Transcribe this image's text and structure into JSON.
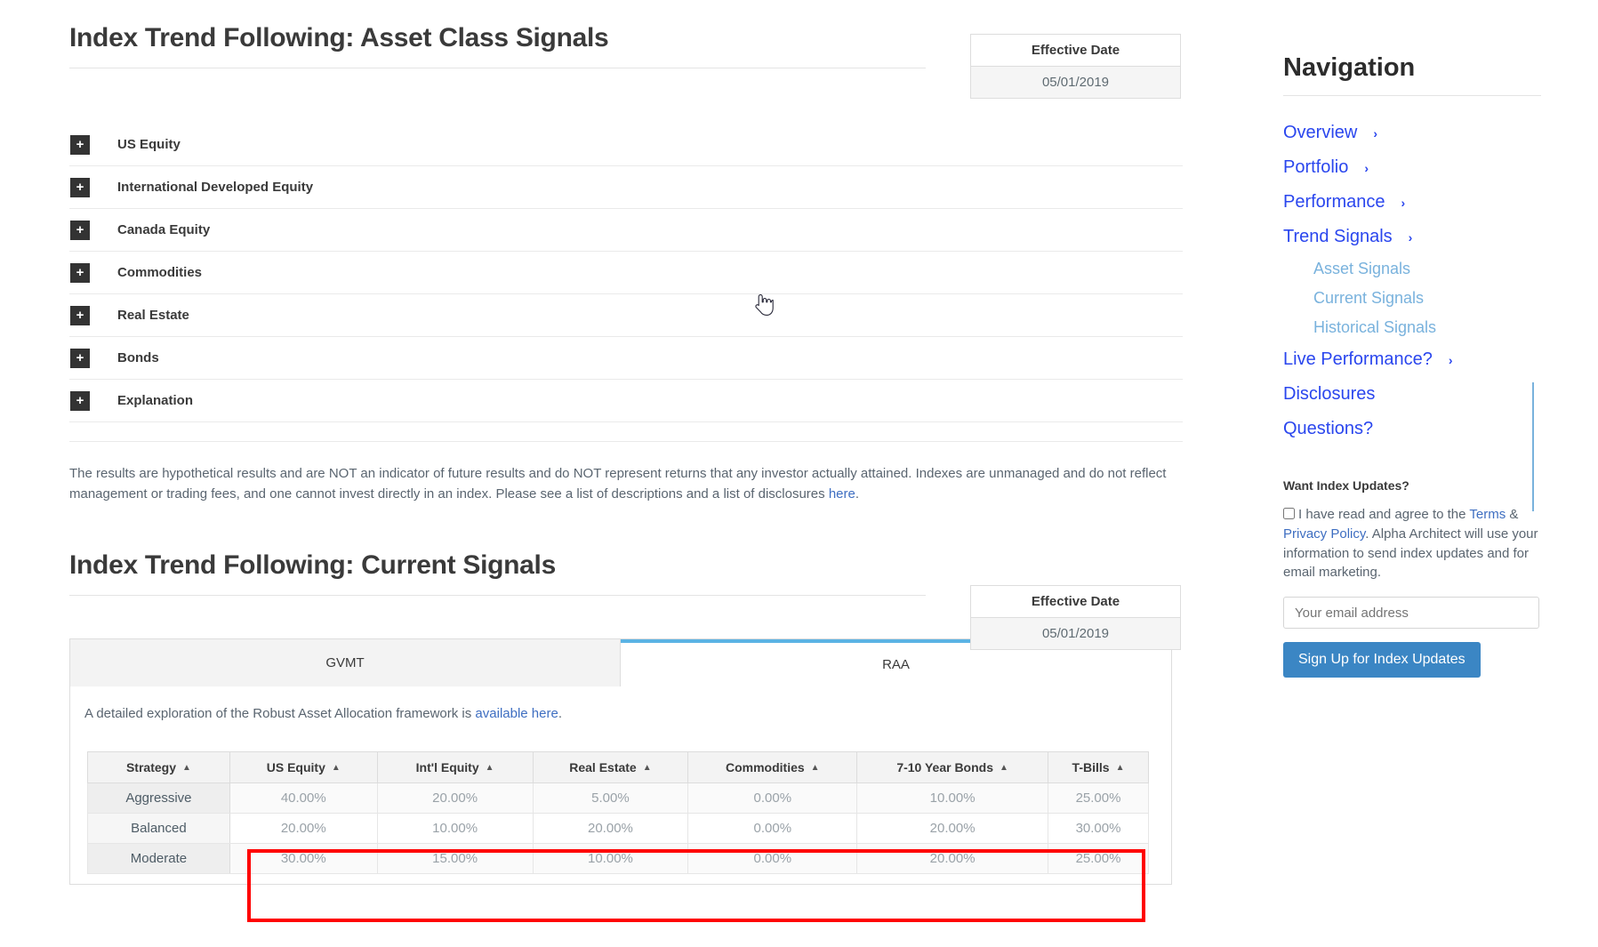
{
  "sections": [
    {
      "title": "Index Trend Following: Asset Class Signals",
      "effective_date": {
        "label": "Effective Date",
        "value": "05/01/2019"
      }
    },
    {
      "title": "Index Trend Following: Current Signals",
      "effective_date": {
        "label": "Effective Date",
        "value": "05/01/2019"
      }
    }
  ],
  "accordion": {
    "expand_icon": "+",
    "items": [
      {
        "label": "US Equity"
      },
      {
        "label": "International Developed Equity"
      },
      {
        "label": "Canada Equity"
      },
      {
        "label": "Commodities"
      },
      {
        "label": "Real Estate"
      },
      {
        "label": "Bonds"
      },
      {
        "label": "Explanation"
      }
    ]
  },
  "disclaimer": {
    "text_before_link": "The results are hypothetical results and are NOT an indicator of future results and do NOT represent returns that any investor actually attained. Indexes are unmanaged and do not reflect management or trading fees, and one cannot invest directly in an index. Please see a list of descriptions and a list of disclosures ",
    "link_text": "here",
    "text_after_link": "."
  },
  "tabs": [
    {
      "label": "GVMT",
      "active": false
    },
    {
      "label": "RAA",
      "active": true
    }
  ],
  "panel": {
    "note_before_link": "A detailed exploration of the Robust Asset Allocation framework is ",
    "note_link": "available here",
    "note_after_link": "."
  },
  "chart_data": {
    "type": "table",
    "title": "Index Trend Following: Current Signals — RAA",
    "columns": [
      "Strategy",
      "US Equity",
      "Int'l Equity",
      "Real Estate",
      "Commodities",
      "7-10 Year Bonds",
      "T-Bills"
    ],
    "sort_indicator": "▲",
    "rows": [
      {
        "Strategy": "Aggressive",
        "US Equity": "40.00%",
        "Int'l Equity": "20.00%",
        "Real Estate": "5.00%",
        "Commodities": "0.00%",
        "7-10 Year Bonds": "10.00%",
        "T-Bills": "25.00%"
      },
      {
        "Strategy": "Balanced",
        "US Equity": "20.00%",
        "Int'l Equity": "10.00%",
        "Real Estate": "20.00%",
        "Commodities": "0.00%",
        "7-10 Year Bonds": "20.00%",
        "T-Bills": "30.00%"
      },
      {
        "Strategy": "Moderate",
        "US Equity": "30.00%",
        "Int'l Equity": "15.00%",
        "Real Estate": "10.00%",
        "Commodities": "0.00%",
        "7-10 Year Bonds": "20.00%",
        "T-Bills": "25.00%"
      }
    ]
  },
  "annotation": {
    "highlight_color": "#ff0000"
  },
  "sidebar": {
    "title": "Navigation",
    "chevron": "›",
    "items": [
      {
        "label": "Overview",
        "has_chevron": true,
        "sub": false
      },
      {
        "label": "Portfolio",
        "has_chevron": true,
        "sub": false
      },
      {
        "label": "Performance",
        "has_chevron": true,
        "sub": false
      },
      {
        "label": "Trend Signals",
        "has_chevron": true,
        "sub": false
      },
      {
        "label": "Asset Signals",
        "has_chevron": false,
        "sub": true
      },
      {
        "label": "Current Signals",
        "has_chevron": false,
        "sub": true
      },
      {
        "label": "Historical Signals",
        "has_chevron": false,
        "sub": true
      },
      {
        "label": "Live Performance?",
        "has_chevron": true,
        "sub": false
      },
      {
        "label": "Disclosures",
        "has_chevron": false,
        "sub": false
      },
      {
        "label": "Questions?",
        "has_chevron": false,
        "sub": false
      }
    ],
    "updates": {
      "title": "Want Index Updates?",
      "consent_1": "I have read and agree to the ",
      "terms_link": "Terms",
      "consent_2": " & ",
      "privacy_link": "Privacy Policy",
      "consent_3": ". Alpha Architect will use your information to send index updates and for email marketing.",
      "email_placeholder": "Your email address",
      "email_value": "",
      "button_label": "Sign Up for Index Updates"
    }
  }
}
